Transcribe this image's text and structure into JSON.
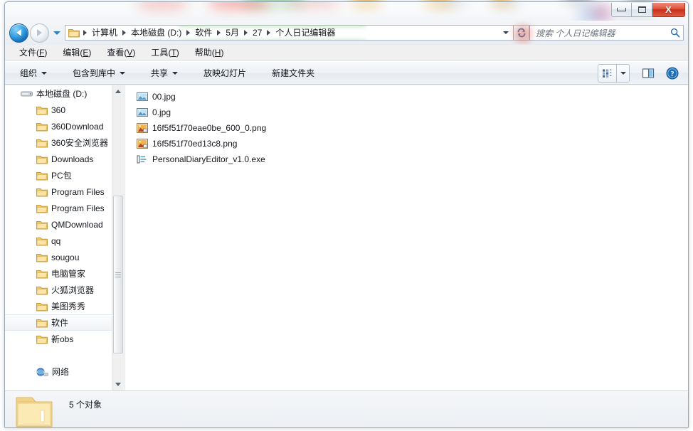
{
  "window": {
    "controls": {
      "minimize_label": "最小化",
      "maximize_label": "最大化",
      "close_label": "X"
    }
  },
  "addressbar": {
    "back_label": "后退",
    "forward_label": "前进",
    "history_label": "最近访问的位置",
    "crumbs": [
      "计算机",
      "本地磁盘 (D:)",
      "软件",
      "5月",
      "27",
      "个人日记编辑器"
    ],
    "refresh_label": "刷新",
    "dropdown_label": "以前的位置"
  },
  "search": {
    "placeholder": "搜索 个人日记编辑器",
    "icon": "search-icon"
  },
  "menubar": {
    "items": [
      {
        "text": "文件",
        "mnemonic": "F"
      },
      {
        "text": "编辑",
        "mnemonic": "E"
      },
      {
        "text": "查看",
        "mnemonic": "V"
      },
      {
        "text": "工具",
        "mnemonic": "T"
      },
      {
        "text": "帮助",
        "mnemonic": "H"
      }
    ]
  },
  "toolbar": {
    "organize_label": "组织",
    "include_library_label": "包含到库中",
    "share_label": "共享",
    "slideshow_label": "放映幻灯片",
    "new_folder_label": "新建文件夹",
    "view_options_icon": "view-options-icon",
    "view_dropdown_icon": "chevron-down-icon",
    "preview_pane_icon": "preview-pane-icon",
    "help_icon": "help-icon"
  },
  "navigation": {
    "root": {
      "label": "本地磁盘 (D:)",
      "icon": "drive-icon"
    },
    "items": [
      {
        "label": "360",
        "icon": "folder-icon",
        "selected": false
      },
      {
        "label": "360Download",
        "icon": "folder-icon",
        "selected": false
      },
      {
        "label": "360安全浏览器",
        "icon": "folder-icon",
        "selected": false
      },
      {
        "label": "Downloads",
        "icon": "folder-icon",
        "selected": false
      },
      {
        "label": "PC包",
        "icon": "folder-icon",
        "selected": false
      },
      {
        "label": "Program Files",
        "icon": "folder-icon",
        "selected": false
      },
      {
        "label": "Program Files",
        "icon": "folder-icon",
        "selected": false
      },
      {
        "label": "QMDownload",
        "icon": "folder-icon",
        "selected": false
      },
      {
        "label": "qq",
        "icon": "folder-icon",
        "selected": false
      },
      {
        "label": "sougou",
        "icon": "folder-icon",
        "selected": false
      },
      {
        "label": "电脑管家",
        "icon": "folder-icon",
        "selected": false
      },
      {
        "label": "火狐浏览器",
        "icon": "folder-icon",
        "selected": false
      },
      {
        "label": "美图秀秀",
        "icon": "folder-icon",
        "selected": false
      },
      {
        "label": "软件",
        "icon": "folder-icon",
        "selected": true
      },
      {
        "label": "新obs",
        "icon": "folder-icon",
        "selected": false
      }
    ],
    "network": {
      "label": "网络",
      "icon": "network-icon"
    }
  },
  "files": [
    {
      "name": "00.jpg",
      "icon": "jpg-image-icon"
    },
    {
      "name": "0.jpg",
      "icon": "jpg-image-icon"
    },
    {
      "name": "16f5f51f70eae0be_600_0.png",
      "icon": "png-image-icon"
    },
    {
      "name": "16f5f51f70ed13c8.png",
      "icon": "png-image-icon"
    },
    {
      "name": "PersonalDiaryEditor_v1.0.exe",
      "icon": "executable-icon"
    }
  ],
  "details": {
    "item_count_text": "5 个对象",
    "folder_icon": "large-folder-icon"
  },
  "colors": {
    "accent_blue": "#1267b4",
    "close_red": "#c8301a",
    "folder_yellow": "#fcd77f",
    "green_wash": "#4ab454",
    "selection_gray": "#f1f4f7"
  }
}
